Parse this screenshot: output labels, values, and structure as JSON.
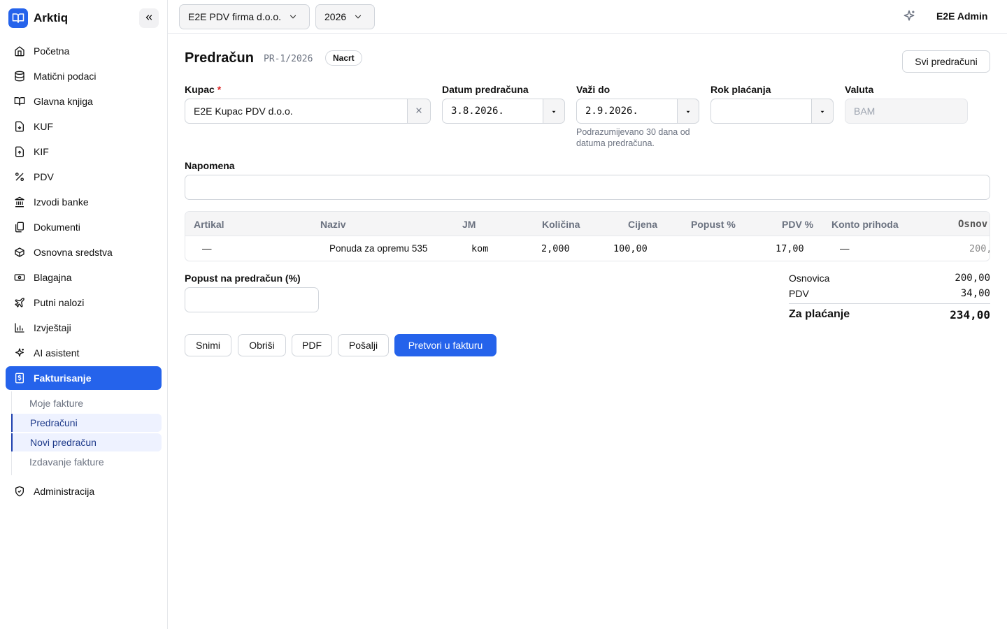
{
  "app": {
    "name": "Arktiq"
  },
  "sidebar": {
    "items": [
      {
        "label": "Početna",
        "icon": "home-icon"
      },
      {
        "label": "Matični podaci",
        "icon": "database-icon"
      },
      {
        "label": "Glavna knjiga",
        "icon": "book-icon"
      },
      {
        "label": "KUF",
        "icon": "file-in-icon"
      },
      {
        "label": "KIF",
        "icon": "file-out-icon"
      },
      {
        "label": "PDV",
        "icon": "percent-icon"
      },
      {
        "label": "Izvodi banke",
        "icon": "bank-icon"
      },
      {
        "label": "Dokumenti",
        "icon": "documents-icon"
      },
      {
        "label": "Osnovna sredstva",
        "icon": "box-icon"
      },
      {
        "label": "Blagajna",
        "icon": "cash-icon"
      },
      {
        "label": "Putni nalozi",
        "icon": "plane-icon"
      },
      {
        "label": "Izvještaji",
        "icon": "chart-icon"
      },
      {
        "label": "AI asistent",
        "icon": "sparkle-icon"
      },
      {
        "label": "Fakturisanje",
        "icon": "invoice-icon",
        "active": true
      }
    ],
    "sub_items": [
      {
        "label": "Moje fakture"
      },
      {
        "label": "Predračuni",
        "selected": true
      },
      {
        "label": "Novi predračun",
        "selected": true
      },
      {
        "label": "Izdavanje fakture"
      }
    ],
    "admin": {
      "label": "Administracija",
      "icon": "shield-icon"
    }
  },
  "topbar": {
    "company": "E2E PDV firma d.o.o.",
    "year": "2026",
    "user": "E2E Admin"
  },
  "page": {
    "title": "Predračun",
    "doc_number": "PR-1/2026",
    "status": "Nacrt",
    "all_button": "Svi predračuni"
  },
  "form": {
    "customer_label": "Kupac",
    "customer_required": "*",
    "customer_value": "E2E Kupac PDV d.o.o.",
    "date_label": "Datum predračuna",
    "date_value": "3.8.2026.",
    "valid_label": "Važi do",
    "valid_value": "2.9.2026.",
    "valid_help": "Podrazumijevano 30 dana od datuma predračuna.",
    "payment_label": "Rok plaćanja",
    "payment_value": "",
    "currency_label": "Valuta",
    "currency_placeholder": "BAM",
    "note_label": "Napomena",
    "note_value": "",
    "discount_label": "Popust na predračun (%)",
    "discount_value": ""
  },
  "table": {
    "columns": [
      "Artikal",
      "Naziv",
      "JM",
      "Količina",
      "Cijena",
      "Popust %",
      "PDV %",
      "Konto prihoda",
      "Osnov:"
    ],
    "rows": [
      {
        "artikal": "—",
        "naziv": "Ponuda za opremu 535",
        "jm": "kom",
        "kolicina": "2,000",
        "cijena": "100,00",
        "popust": "",
        "pdv": "17,00",
        "konto": "—",
        "osnovica": "200,"
      }
    ]
  },
  "totals": {
    "base_label": "Osnovica",
    "base_value": "200,00",
    "vat_label": "PDV",
    "vat_value": "34,00",
    "total_label": "Za plaćanje",
    "total_value": "234,00"
  },
  "actions": {
    "save": "Snimi",
    "delete": "Obriši",
    "pdf": "PDF",
    "send": "Pošalji",
    "convert": "Pretvori u fakturu"
  },
  "colors": {
    "accent": "#2563eb",
    "required": "#dc2626"
  }
}
